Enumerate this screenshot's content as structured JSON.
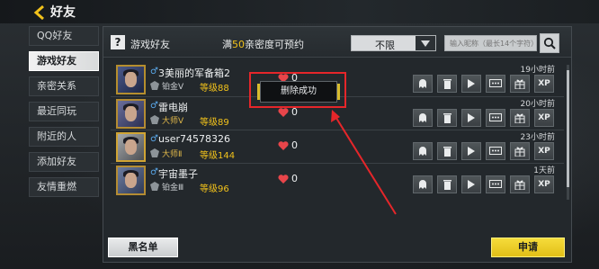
{
  "header": {
    "title": "好友"
  },
  "sidebar": {
    "items": [
      {
        "label": "QQ好友"
      },
      {
        "label": "游戏好友"
      },
      {
        "label": "亲密关系"
      },
      {
        "label": "最近同玩"
      },
      {
        "label": "附近的人"
      },
      {
        "label": "添加好友"
      },
      {
        "label": "友情重燃"
      }
    ],
    "active_index": 1
  },
  "panel": {
    "help_icon": "?",
    "title": "游戏好友",
    "note_prefix": "满",
    "note_number": "50",
    "note_suffix": "亲密度可预约",
    "filter_value": "不限",
    "search_placeholder": "输入昵称（最长14个字符）"
  },
  "friends": [
    {
      "name": "3美丽的军备箱2",
      "rank": "铂金Ⅴ",
      "level": "等级88",
      "hearts": "0",
      "online": "19小时前"
    },
    {
      "name": "雷电崩",
      "rank": "大师Ⅴ",
      "level": "等级89",
      "hearts": "0",
      "online": "20小时前"
    },
    {
      "name": "user74578326",
      "rank": "大师Ⅱ",
      "level": "等级144",
      "hearts": "0",
      "online": "23小时前"
    },
    {
      "name": "宇宙墨子",
      "rank": "铂金Ⅲ",
      "level": "等级96",
      "hearts": "0",
      "online": "1天前"
    }
  ],
  "action_icons": [
    "ghost-icon",
    "trash-icon",
    "play-icon",
    "chat-icon",
    "gift-icon",
    "xp-icon"
  ],
  "action_xp_label": "XP",
  "toast": {
    "message": "删除成功"
  },
  "buttons": {
    "blacklist": "黑名单",
    "apply": "申请"
  },
  "colors": {
    "accent_yellow": "#f2c21b",
    "highlight_red": "#e5262a"
  }
}
